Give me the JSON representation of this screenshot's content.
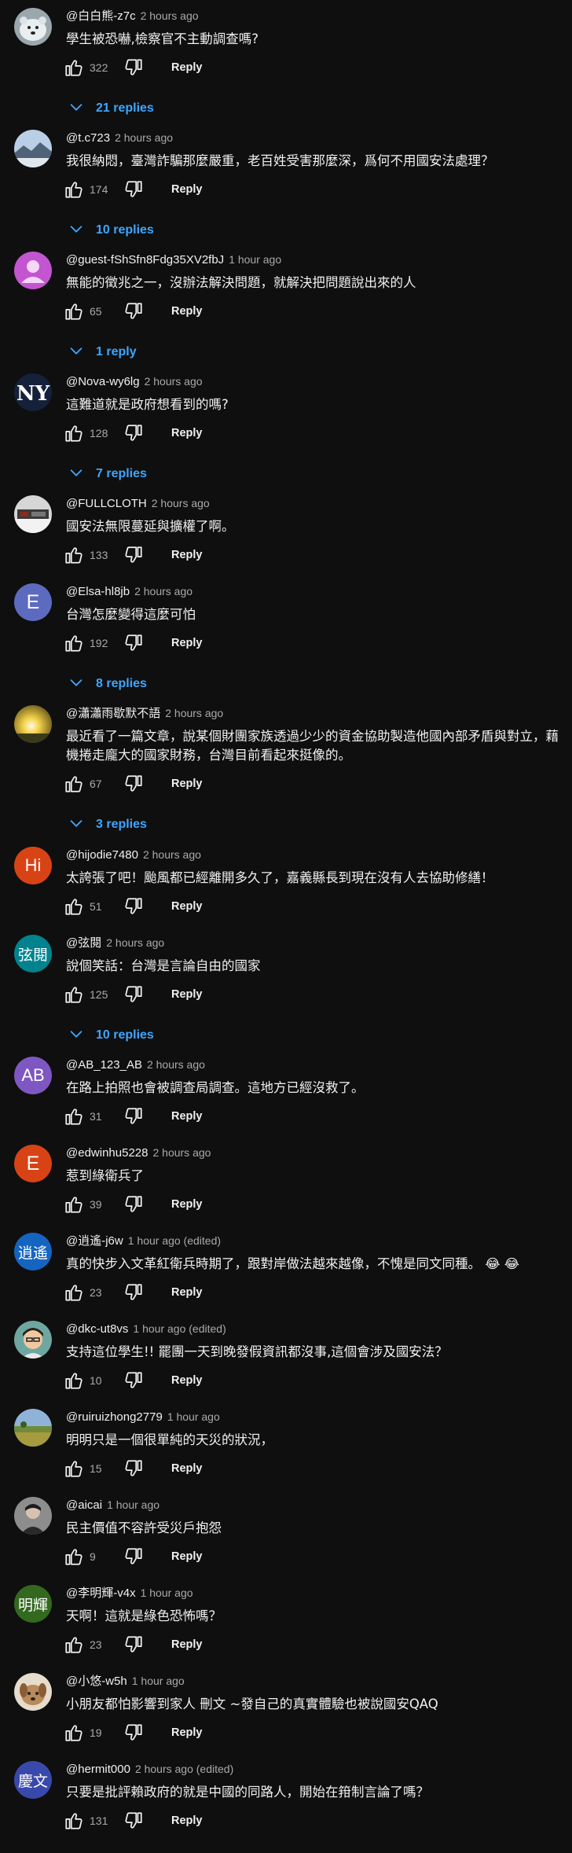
{
  "reply_label": "Reply",
  "colors": {
    "background": "#0f0f0f",
    "link_blue": "#3ea6ff",
    "secondary_text": "#aaaaaa",
    "primary_text": "#f1f1f1"
  },
  "comments": [
    {
      "author": "@白白熊-z7c",
      "time": "2 hours ago",
      "text": "學生被恐嚇,檢察官不主動調查嗎?",
      "likes": "322",
      "replies": "21 replies",
      "avatar": {
        "kind": "image",
        "icon": "polar-bear-photo"
      }
    },
    {
      "author": "@t.c723",
      "time": "2 hours ago",
      "text": "我很納悶，臺灣詐騙那麼嚴重，老百姓受害那麼深，爲何不用國安法處理？",
      "likes": "174",
      "replies": "10 replies",
      "avatar": {
        "kind": "image",
        "icon": "landscape-photo"
      }
    },
    {
      "author": "@guest-fShSfn8Fdg35XV2fbJ",
      "time": "1 hour ago",
      "text": "無能的徵兆之一，沒辦法解決問題，就解決把問題說出來的人",
      "likes": "65",
      "replies": "1 reply",
      "avatar": {
        "kind": "image",
        "icon": "default-person-icon"
      }
    },
    {
      "author": "@Nova-wy6lg",
      "time": "2 hours ago",
      "text": "這難道就是政府想看到的嗎?",
      "likes": "128",
      "replies": "7 replies",
      "avatar": {
        "kind": "image",
        "icon": "yankees-logo"
      }
    },
    {
      "author": "@FULLCLOTH",
      "time": "2 hours ago",
      "text": "國安法無限蔓延與擴權了啊。",
      "likes": "133",
      "replies": "",
      "avatar": {
        "kind": "image",
        "icon": "kitchen-photo"
      }
    },
    {
      "author": "@Elsa-hl8jb",
      "time": "2 hours ago",
      "text": "台灣怎麼變得這麼可怕",
      "likes": "192",
      "replies": "8 replies",
      "avatar": {
        "kind": "letter",
        "letter": "E",
        "color": "#5c6bc0"
      }
    },
    {
      "author": "@瀟瀟雨歇默不語",
      "time": "2 hours ago",
      "text": "最近看了一篇文章，說某個財團家族透過少少的資金協助製造他國內部矛盾與對立，藉機捲走龐大的國家財務，台灣目前看起來挺像的。",
      "likes": "67",
      "replies": "3 replies",
      "avatar": {
        "kind": "image",
        "icon": "sunset-photo"
      }
    },
    {
      "author": "@hijodie7480",
      "time": "2 hours ago",
      "text": "太誇張了吧！颱風都已經離開多久了，嘉義縣長到現在沒有人去協助修繕！",
      "likes": "51",
      "replies": "",
      "avatar": {
        "kind": "letter",
        "letter": "Hi",
        "color": "#d84315"
      }
    },
    {
      "author": "@弦閱",
      "time": "2 hours ago",
      "text": "說個笑話：台灣是言論自由的國家",
      "likes": "125",
      "replies": "10 replies",
      "avatar": {
        "kind": "letter",
        "letter": "弦閱",
        "color": "#00838f"
      }
    },
    {
      "author": "@AB_123_AB",
      "time": "2 hours ago",
      "text": "在路上拍照也會被調查局調查。這地方已經沒救了。",
      "likes": "31",
      "replies": "",
      "avatar": {
        "kind": "letter",
        "letter": "AB",
        "color": "#7e57c2"
      }
    },
    {
      "author": "@edwinhu5228",
      "time": "2 hours ago",
      "text": "惹到綠衛兵了",
      "likes": "39",
      "replies": "",
      "avatar": {
        "kind": "letter",
        "letter": "E",
        "color": "#d84315"
      }
    },
    {
      "author": "@逍遙-j6w",
      "time": "1 hour ago (edited)",
      "text": "真的快步入文革紅衛兵時期了，跟對岸做法越來越像，不愧是同文同種。 😂 😂",
      "likes": "23",
      "replies": "",
      "avatar": {
        "kind": "letter",
        "letter": "逍遙",
        "color": "#1565c0"
      }
    },
    {
      "author": "@dkc-ut8vs",
      "time": "1 hour ago (edited)",
      "text": "支持這位學生!! 罷團一天到晚發假資訊都沒事,這個會涉及國安法？",
      "likes": "10",
      "replies": "",
      "avatar": {
        "kind": "image",
        "icon": "cartoon-boy-avatar"
      }
    },
    {
      "author": "@ruiruizhong2779",
      "time": "1 hour ago",
      "text": "明明只是一個很單純的天災的狀況，",
      "likes": "15",
      "replies": "",
      "avatar": {
        "kind": "image",
        "icon": "field-photo"
      }
    },
    {
      "author": "@aicai",
      "time": "1 hour ago",
      "text": "民主價值不容許受災戶抱怨",
      "likes": "9",
      "replies": "",
      "avatar": {
        "kind": "image",
        "icon": "person-photo"
      }
    },
    {
      "author": "@李明輝-v4x",
      "time": "1 hour ago",
      "text": "天啊！這就是綠色恐怖嗎？",
      "likes": "23",
      "replies": "",
      "avatar": {
        "kind": "letter",
        "letter": "明輝",
        "color": "#33691e"
      }
    },
    {
      "author": "@小悠-w5h",
      "time": "1 hour ago",
      "text": "小朋友都怕影響到家人 刪文 ~發自己的真實體驗也被說國安QAQ",
      "likes": "19",
      "replies": "",
      "avatar": {
        "kind": "image",
        "icon": "dog-photo"
      }
    },
    {
      "author": "@hermit000",
      "time": "2 hours ago (edited)",
      "text": "只要是批評賴政府的就是中國的同路人，開始在箝制言論了嗎？",
      "likes": "131",
      "replies": "",
      "avatar": {
        "kind": "letter",
        "letter": "慶文",
        "color": "#3949ab"
      }
    }
  ]
}
